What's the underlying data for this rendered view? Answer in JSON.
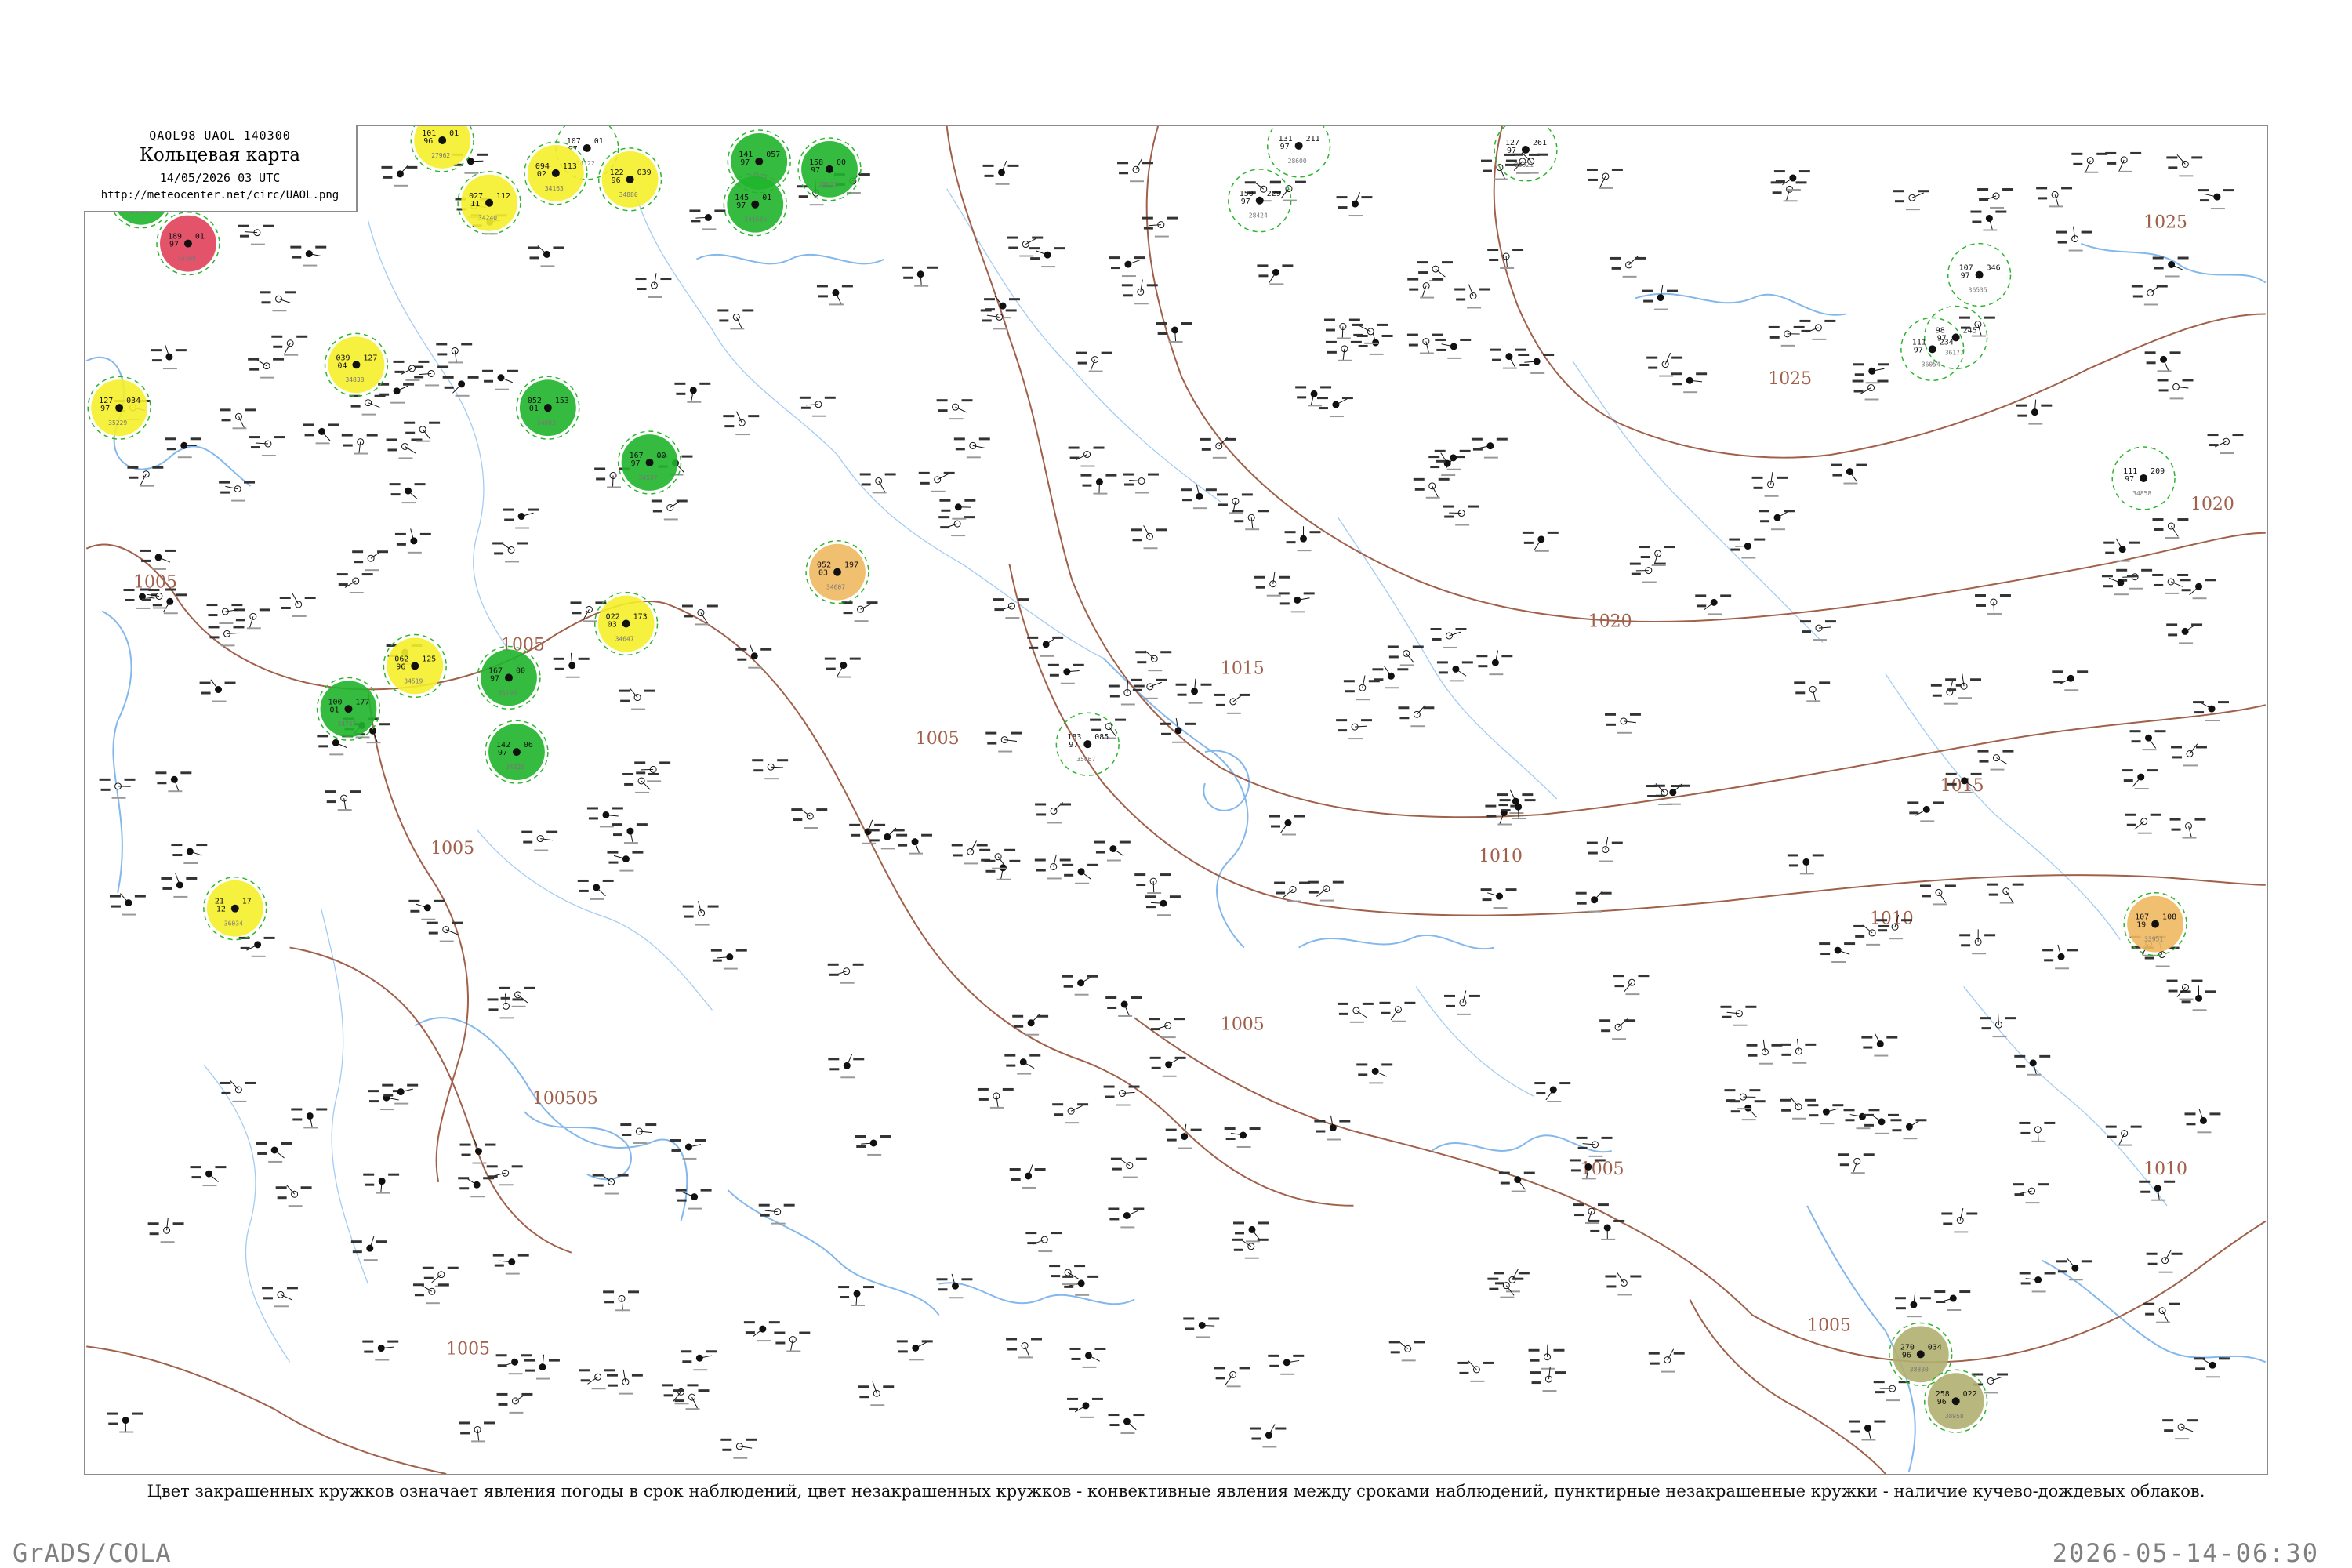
{
  "header": {
    "code": "QAOL98  UAOL  140300",
    "title": "Кольцевая карта",
    "datetime": "14/05/2026 03 UTC",
    "url": "http://meteocenter.net/circ/UAOL.png"
  },
  "legend": {
    "caption": "Цвет закрашенных кружков означает явления погоды в срок наблюдений, цвет незакрашенных кружков - конвективные явления между сроками наблюдений, пунктирные незакрашенные кружки - наличие кучево-дождевых облаков."
  },
  "footer": {
    "left": "GrADS/COLA",
    "right": "2026-05-14-06:30"
  },
  "colors": {
    "isobar": "#a0604a",
    "river": "#5aa0e6",
    "border": "#8c8c8c",
    "rain": "#1fb52b",
    "drizzle_haze": "#f5ee2a",
    "fog": "#f0b860",
    "thunder": "#e0405a",
    "dust": "#b0b070",
    "cb_outline": "#2db52d"
  },
  "isobars": [
    {
      "label": "1025"
    },
    {
      "label": "1025"
    },
    {
      "label": "1020"
    },
    {
      "label": "1020"
    },
    {
      "label": "1015"
    },
    {
      "label": "1015"
    },
    {
      "label": "1010"
    },
    {
      "label": "1010"
    },
    {
      "label": "1010"
    },
    {
      "label": "1005"
    },
    {
      "label": "1005"
    },
    {
      "label": "1005"
    },
    {
      "label": "1005"
    },
    {
      "label": "1005"
    },
    {
      "label": "1005"
    },
    {
      "label": "1005"
    },
    {
      "label": "1005"
    },
    {
      "label": "100505"
    }
  ],
  "stations": [
    {
      "id": "34122",
      "pressure": "107",
      "temp": "97",
      "wx": "01",
      "kind": "plain"
    },
    {
      "id": "34163",
      "pressure": "094",
      "temp": "02",
      "wx": "113",
      "kind": "drizzle_haze"
    },
    {
      "id": "27962",
      "pressure": "101",
      "temp": "96",
      "wx": "01",
      "kind": "drizzle_haze"
    },
    {
      "id": "34240",
      "pressure": "027",
      "temp": "11",
      "wx": "112",
      "kind": "drizzle_haze"
    },
    {
      "id": "34838",
      "pressure": "039",
      "temp": "04",
      "wx": "127",
      "kind": "drizzle_haze"
    },
    {
      "id": "34880",
      "pressure": "122",
      "temp": "96",
      "wx": "039",
      "kind": "drizzle_haze"
    },
    {
      "id": "34647",
      "pressure": "022",
      "temp": "03",
      "wx": "173",
      "kind": "drizzle_haze"
    },
    {
      "id": "34519",
      "pressure": "062",
      "temp": "96",
      "wx": "125",
      "kind": "drizzle_haze"
    },
    {
      "id": "35229",
      "pressure": "127",
      "temp": "97",
      "wx": "034",
      "kind": "drizzle_haze"
    },
    {
      "id": "36034",
      "pressure": "21",
      "temp": "12",
      "wx": "17",
      "kind": "drizzle_haze"
    },
    {
      "id": "34607",
      "pressure": "052",
      "temp": "03",
      "wx": "197",
      "kind": "fog"
    },
    {
      "id": "33951",
      "pressure": "107",
      "temp": "19",
      "wx": "108",
      "kind": "fog"
    },
    {
      "id": "34309",
      "pressure": "189",
      "temp": "97",
      "wx": "01",
      "kind": "thunder"
    },
    {
      "id": "34139",
      "pressure": "123",
      "temp": "97",
      "wx": "005",
      "kind": "rain"
    },
    {
      "id": "27974",
      "pressure": "141",
      "temp": "97",
      "wx": "057",
      "kind": "rain"
    },
    {
      "id": "28011",
      "pressure": "158",
      "temp": "97",
      "wx": "00",
      "kind": "rain"
    },
    {
      "id": "34083",
      "pressure": "052",
      "temp": "01",
      "wx": "153",
      "kind": "rain"
    },
    {
      "id": "34537",
      "pressure": "167",
      "temp": "97",
      "wx": "00",
      "kind": "rain"
    },
    {
      "id": "34747",
      "pressure": "100",
      "temp": "01",
      "wx": "177",
      "kind": "rain"
    },
    {
      "id": "35108",
      "pressure": "167",
      "temp": "97",
      "wx": "00",
      "kind": "rain"
    },
    {
      "id": "34163b",
      "pressure": "145",
      "temp": "97",
      "wx": "01",
      "kind": "rain"
    },
    {
      "id": "34826",
      "pressure": "142",
      "temp": "97",
      "wx": "06",
      "kind": "rain"
    },
    {
      "id": "38880",
      "pressure": "270",
      "temp": "96",
      "wx": "034",
      "kind": "dust"
    },
    {
      "id": "38958",
      "pressure": "258",
      "temp": "96",
      "wx": "022",
      "kind": "dust"
    },
    {
      "id": "28600",
      "pressure": "131",
      "temp": "97",
      "wx": "211",
      "kind": "plain"
    },
    {
      "id": "23921",
      "pressure": "127",
      "temp": "97",
      "wx": "261",
      "kind": "plain"
    },
    {
      "id": "28424",
      "pressure": "150",
      "temp": "97",
      "wx": "229",
      "kind": "plain"
    },
    {
      "id": "36535",
      "pressure": "107",
      "temp": "97",
      "wx": "346",
      "kind": "plain"
    },
    {
      "id": "34858",
      "pressure": "111",
      "temp": "97",
      "wx": "209",
      "kind": "plain"
    },
    {
      "id": "35067",
      "pressure": "183",
      "temp": "97",
      "wx": "085",
      "kind": "plain"
    },
    {
      "id": "36177",
      "pressure": "98",
      "temp": "97",
      "wx": "245",
      "kind": "plain"
    },
    {
      "id": "36054",
      "pressure": "111",
      "temp": "97",
      "wx": "234",
      "kind": "plain"
    }
  ]
}
